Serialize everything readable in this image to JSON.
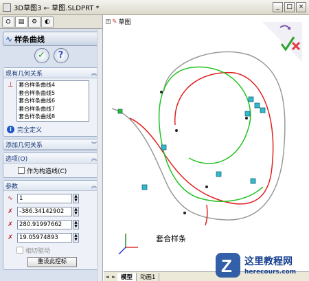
{
  "window": {
    "title": "3D草图3 ← 草图.SLDPRT *",
    "controls": [
      "_",
      "□",
      "×"
    ]
  },
  "left_panel": {
    "tabs": [
      "feature-manager",
      "property-manager",
      "configuration-manager",
      "display-manager"
    ],
    "header_title": "样条曲线",
    "ok_label": "✓",
    "help_label": "?",
    "relations": {
      "title": "现有几何关系",
      "items": [
        "套合样条曲线4",
        "套合样条曲线5",
        "套合样条曲线6",
        "套合样条曲线7",
        "套合样条曲线8"
      ],
      "status": "完全定义"
    },
    "add_relations": {
      "title": "添加几何关系"
    },
    "options": {
      "title": "选项(O)",
      "construction_label": "作为构造线(C)"
    },
    "parameters": {
      "title": "参数",
      "fields": [
        {
          "icon": "spline-point-icon",
          "value": "1"
        },
        {
          "icon": "x-coordinate-icon",
          "value": "-386.34142902"
        },
        {
          "icon": "y-coordinate-icon",
          "value": "280.91997662"
        },
        {
          "icon": "z-coordinate-icon",
          "value": "19.05974893"
        }
      ],
      "tangent_label": "相切驱动",
      "reset_label": "重设此控标"
    }
  },
  "graphics": {
    "tree_label": "草图",
    "shape_label": "套合样条",
    "bottom_tabs": [
      "模型",
      "动画1"
    ],
    "curve_colors": {
      "red": "#e02020",
      "green": "#22c322",
      "gray": "#9a9a9a",
      "handles": "#33b8cc"
    }
  },
  "watermark": {
    "title": "这里教程网",
    "url": "herecours.com"
  }
}
